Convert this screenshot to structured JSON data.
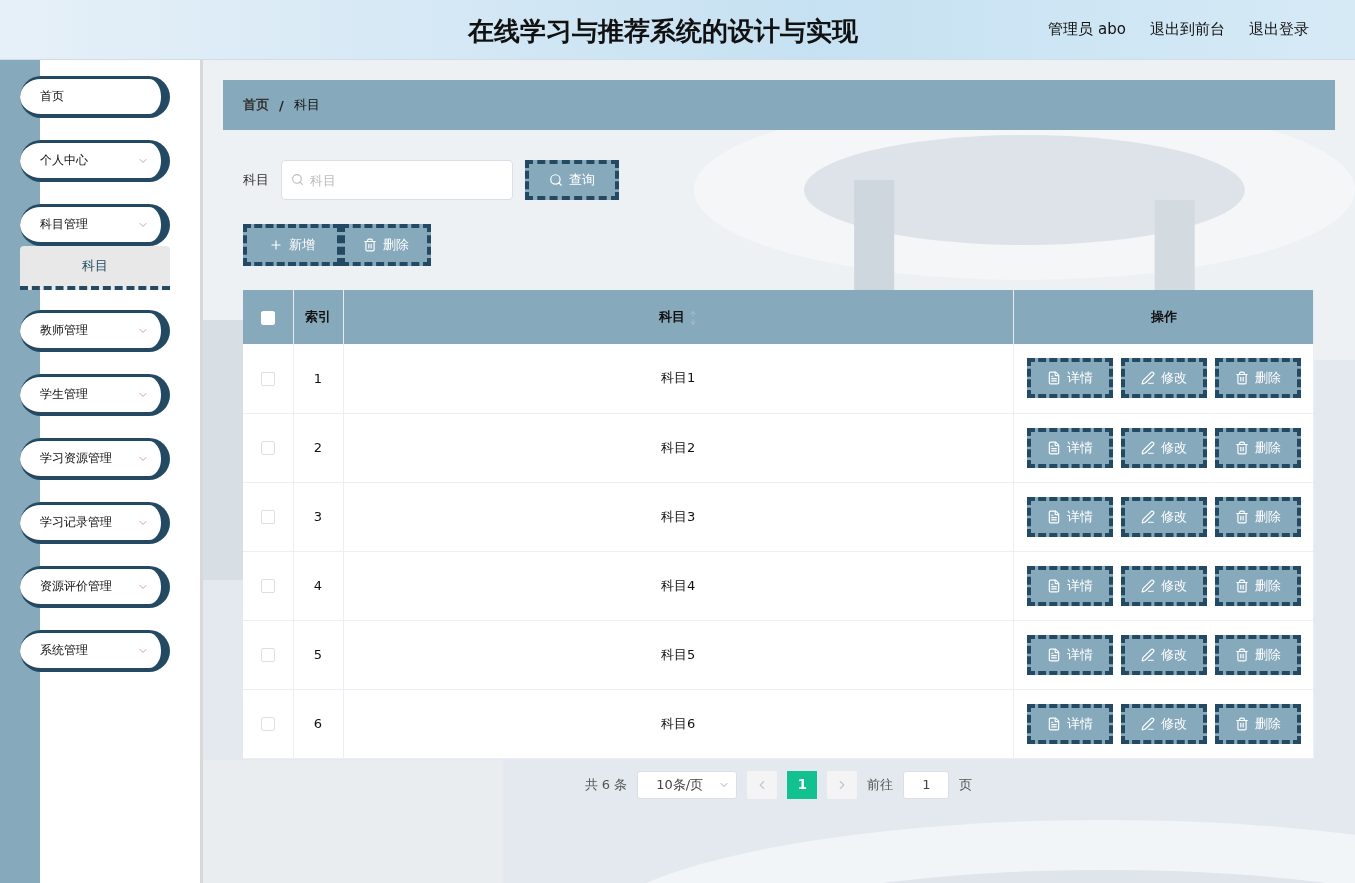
{
  "header": {
    "title": "在线学习与推荐系统的设计与实现",
    "links": [
      "管理员 abo",
      "退出到前台",
      "退出登录"
    ]
  },
  "sidebar": {
    "items": [
      {
        "kind": "link",
        "label": "首页",
        "expanded": false
      },
      {
        "kind": "submenu",
        "label": "个人中心",
        "expanded": false
      },
      {
        "kind": "submenu",
        "label": "科目管理",
        "expanded": true,
        "children": [
          {
            "label": "科目",
            "selected": true
          }
        ]
      },
      {
        "kind": "submenu",
        "label": "教师管理",
        "expanded": false
      },
      {
        "kind": "submenu",
        "label": "学生管理",
        "expanded": false
      },
      {
        "kind": "submenu",
        "label": "学习资源管理",
        "expanded": false
      },
      {
        "kind": "submenu",
        "label": "学习记录管理",
        "expanded": false
      },
      {
        "kind": "submenu",
        "label": "资源评价管理",
        "expanded": false
      },
      {
        "kind": "submenu",
        "label": "系统管理",
        "expanded": false
      }
    ]
  },
  "breadcrumb": {
    "items": [
      "首页",
      "科目"
    ],
    "separator": "/"
  },
  "search": {
    "label": "科目",
    "placeholder": "科目",
    "button": "查询"
  },
  "toolbar": [
    {
      "kind": "add",
      "label": "新增"
    },
    {
      "kind": "delete",
      "label": "删除"
    }
  ],
  "table": {
    "columns": [
      {
        "kind": "check",
        "checked": false
      },
      {
        "kind": "text",
        "label": "索引",
        "sortable": false
      },
      {
        "kind": "text",
        "label": "科目",
        "sortable": true
      },
      {
        "kind": "actions",
        "label": "操作",
        "sortable": false
      }
    ],
    "rows": [
      {
        "checked": false,
        "index": "1",
        "subject": "科目1",
        "actions": [
          {
            "kind": "detail",
            "label": "详情"
          },
          {
            "kind": "edit",
            "label": "修改"
          },
          {
            "kind": "delete",
            "label": "删除"
          }
        ]
      },
      {
        "checked": false,
        "index": "2",
        "subject": "科目2",
        "actions": [
          {
            "kind": "detail",
            "label": "详情"
          },
          {
            "kind": "edit",
            "label": "修改"
          },
          {
            "kind": "delete",
            "label": "删除"
          }
        ]
      },
      {
        "checked": false,
        "index": "3",
        "subject": "科目3",
        "actions": [
          {
            "kind": "detail",
            "label": "详情"
          },
          {
            "kind": "edit",
            "label": "修改"
          },
          {
            "kind": "delete",
            "label": "删除"
          }
        ]
      },
      {
        "checked": false,
        "index": "4",
        "subject": "科目4",
        "actions": [
          {
            "kind": "detail",
            "label": "详情"
          },
          {
            "kind": "edit",
            "label": "修改"
          },
          {
            "kind": "delete",
            "label": "删除"
          }
        ]
      },
      {
        "checked": false,
        "index": "5",
        "subject": "科目5",
        "actions": [
          {
            "kind": "detail",
            "label": "详情"
          },
          {
            "kind": "edit",
            "label": "修改"
          },
          {
            "kind": "delete",
            "label": "删除"
          }
        ]
      },
      {
        "checked": false,
        "index": "6",
        "subject": "科目6",
        "actions": [
          {
            "kind": "detail",
            "label": "详情"
          },
          {
            "kind": "edit",
            "label": "修改"
          },
          {
            "kind": "delete",
            "label": "删除"
          }
        ]
      }
    ]
  },
  "pagination": {
    "total": "共 6 条",
    "page_size": "10条/页",
    "pages": [
      {
        "label": "1",
        "selected": true
      }
    ],
    "goto_label": "前往",
    "goto_value": "1",
    "goto_suffix": "页"
  }
}
